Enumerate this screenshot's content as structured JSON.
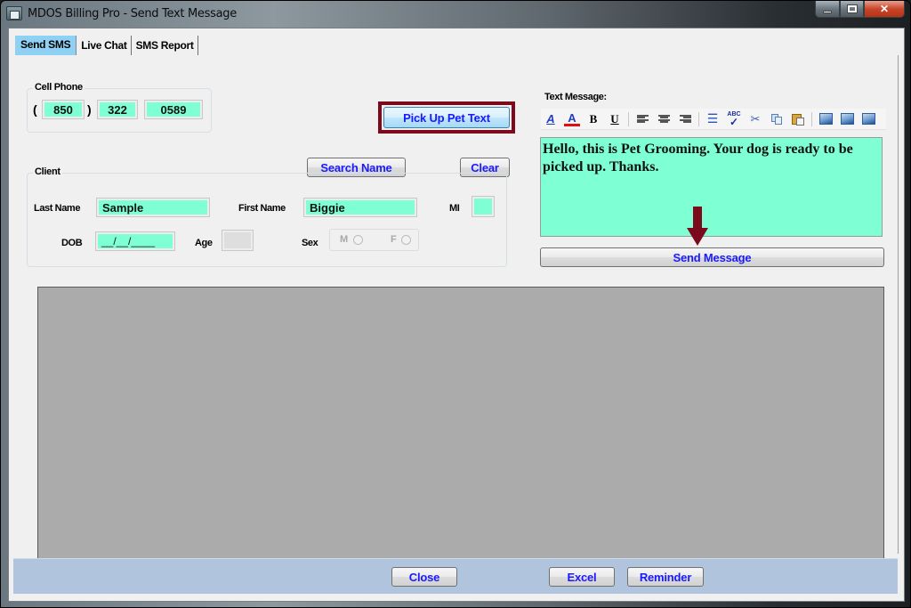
{
  "window": {
    "title": "MDOS Billing Pro - Send Text Message",
    "controls": {
      "minimize": "minimize",
      "maximize": "maximize",
      "close": "close"
    }
  },
  "tabs": [
    {
      "label": "Send SMS",
      "active": true
    },
    {
      "label": "Live Chat",
      "active": false
    },
    {
      "label": "SMS Report",
      "active": false
    }
  ],
  "cell_phone": {
    "group_label": "Cell Phone",
    "open_paren": "(",
    "close_paren": ")",
    "area_code": "850",
    "prefix": "322",
    "line": "0589"
  },
  "buttons": {
    "pick_up_pet_text": "Pick Up Pet Text",
    "search_name": "Search Name",
    "clear": "Clear",
    "send_message": "Send Message",
    "close": "Close",
    "excel": "Excel",
    "reminder": "Reminder"
  },
  "client": {
    "group_label": "Client",
    "last_name_label": "Last Name",
    "last_name": "Sample",
    "first_name_label": "First Name",
    "first_name": "Biggie",
    "mi_label": "MI",
    "mi": "",
    "dob_label": "DOB",
    "dob": "__/__/____",
    "age_label": "Age",
    "age": "",
    "sex_label": "Sex",
    "sex_options": [
      "M",
      "F"
    ]
  },
  "text_message": {
    "label": "Text Message:",
    "body": "Hello, this is Pet Grooming. Your dog is ready to be picked up. Thanks.",
    "toolbar": [
      "font-style-icon",
      "font-color-icon",
      "bold-icon",
      "underline-icon",
      "align-left-icon",
      "align-center-icon",
      "align-right-icon",
      "bullet-list-icon",
      "spell-check-icon",
      "cut-icon",
      "copy-icon",
      "paste-icon",
      "insert-image-icon",
      "insert-image-icon",
      "insert-image-icon"
    ],
    "toolbar_glyphs": {
      "bold": "B",
      "underline": "U",
      "font_color": "A",
      "font_style": "A",
      "spell": "ABC",
      "cut": "✂"
    }
  },
  "colors": {
    "field_bg": "#7fffd4",
    "button_text": "#1a1aff",
    "highlight": "#7d0a1c",
    "active_tab": "#8fd0f5",
    "bottom_bar": "#b0c4de",
    "grid_bg": "#ababab"
  }
}
